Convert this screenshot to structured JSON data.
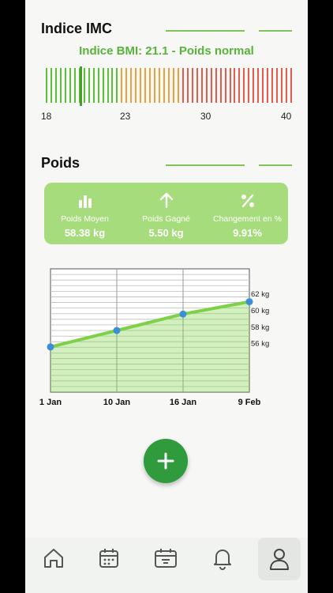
{
  "bmi": {
    "section_title": "Indice IMC",
    "label": "Indice BMI: 21.1 - Poids normal",
    "value": 21.1,
    "scale": [
      "18",
      "23",
      "30",
      "40"
    ],
    "colors": {
      "green": "#5cbf3a",
      "orange": "#e9a13a",
      "red": "#e25b4e"
    }
  },
  "weight": {
    "section_title": "Poids",
    "stats": [
      {
        "icon": "bar-chart-icon",
        "label": "Poids Moyen",
        "value": "58.38 kg"
      },
      {
        "icon": "arrow-up-icon",
        "label": "Poids Gagné",
        "value": "5.50 kg"
      },
      {
        "icon": "percent-icon",
        "label": "Changement en %",
        "value": "9.91%"
      }
    ]
  },
  "chart_data": {
    "type": "area",
    "x": [
      "1 Jan",
      "10 Jan",
      "16 Jan",
      "9 Feb"
    ],
    "y_tick_labels": [
      "62 kg",
      "60 kg",
      "58 kg",
      "56 kg"
    ],
    "series": [
      {
        "values": [
          55.5,
          57.5,
          59.5,
          61.0
        ]
      }
    ],
    "ylim": [
      50,
      65
    ],
    "grid": true,
    "color": "#7ed046"
  },
  "nav": {
    "items": [
      {
        "icon": "home-icon",
        "active": false
      },
      {
        "icon": "calendar-icon",
        "active": false
      },
      {
        "icon": "basket-icon",
        "active": false
      },
      {
        "icon": "bell-icon",
        "active": false
      },
      {
        "icon": "profile-icon",
        "active": true
      }
    ]
  },
  "fab": {
    "icon": "plus-icon",
    "color": "#2f9b3c"
  }
}
